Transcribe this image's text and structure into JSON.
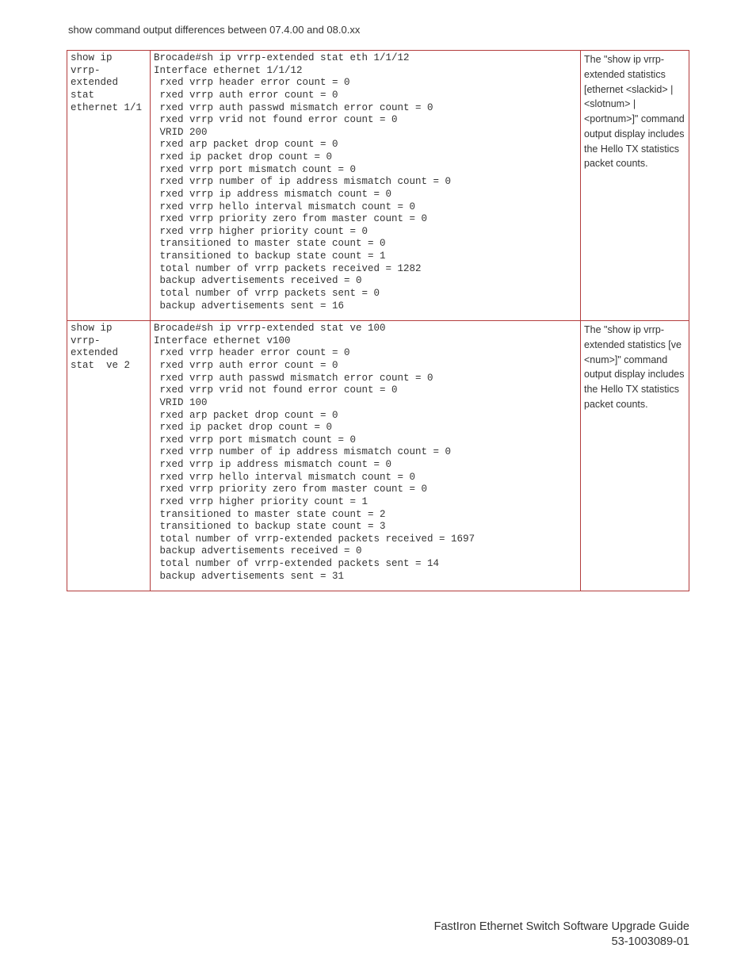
{
  "header": "show command output differences between 07.4.00 and 08.0.xx",
  "row1": {
    "cmd": "show ip vrrp-extended stat ethernet 1/1",
    "out": "Brocade#sh ip vrrp-extended stat eth 1/1/12\nInterface ethernet 1/1/12\n rxed vrrp header error count = 0\n rxed vrrp auth error count = 0\n rxed vrrp auth passwd mismatch error count = 0\n rxed vrrp vrid not found error count = 0\n VRID 200\n rxed arp packet drop count = 0\n rxed ip packet drop count = 0\n rxed vrrp port mismatch count = 0\n rxed vrrp number of ip address mismatch count = 0\n rxed vrrp ip address mismatch count = 0\n rxed vrrp hello interval mismatch count = 0\n rxed vrrp priority zero from master count = 0\n rxed vrrp higher priority count = 0\n transitioned to master state count = 0\n transitioned to backup state count = 1\n total number of vrrp packets received = 1282\n backup advertisements received = 0\n total number of vrrp packets sent = 0\n backup advertisements sent = 16",
    "desc": "The \"show ip vrrp-extended statistics [ethernet <slackid> | <slotnum> | <portnum>]\" command output display includes the  Hello TX statistics packet counts."
  },
  "row2": {
    "cmd": "show ip vrrp-extended stat  ve 2",
    "out": "Brocade#sh ip vrrp-extended stat ve 100\nInterface ethernet v100\n rxed vrrp header error count = 0\n rxed vrrp auth error count = 0\n rxed vrrp auth passwd mismatch error count = 0\n rxed vrrp vrid not found error count = 0\n VRID 100\n rxed arp packet drop count = 0\n rxed ip packet drop count = 0\n rxed vrrp port mismatch count = 0\n rxed vrrp number of ip address mismatch count = 0\n rxed vrrp ip address mismatch count = 0\n rxed vrrp hello interval mismatch count = 0\n rxed vrrp priority zero from master count = 0\n rxed vrrp higher priority count = 1\n transitioned to master state count = 2\n transitioned to backup state count = 3\n total number of vrrp-extended packets received = 1697\n backup advertisements received = 0\n total number of vrrp-extended packets sent = 14\n backup advertisements sent = 31",
    "desc": "The \"show ip vrrp-extended statistics [ve <num>]\" command output display includes the  Hello TX statistics packet counts."
  },
  "footer": {
    "title": "FastIron Ethernet Switch Software Upgrade Guide",
    "docnum": "53-1003089-01"
  }
}
